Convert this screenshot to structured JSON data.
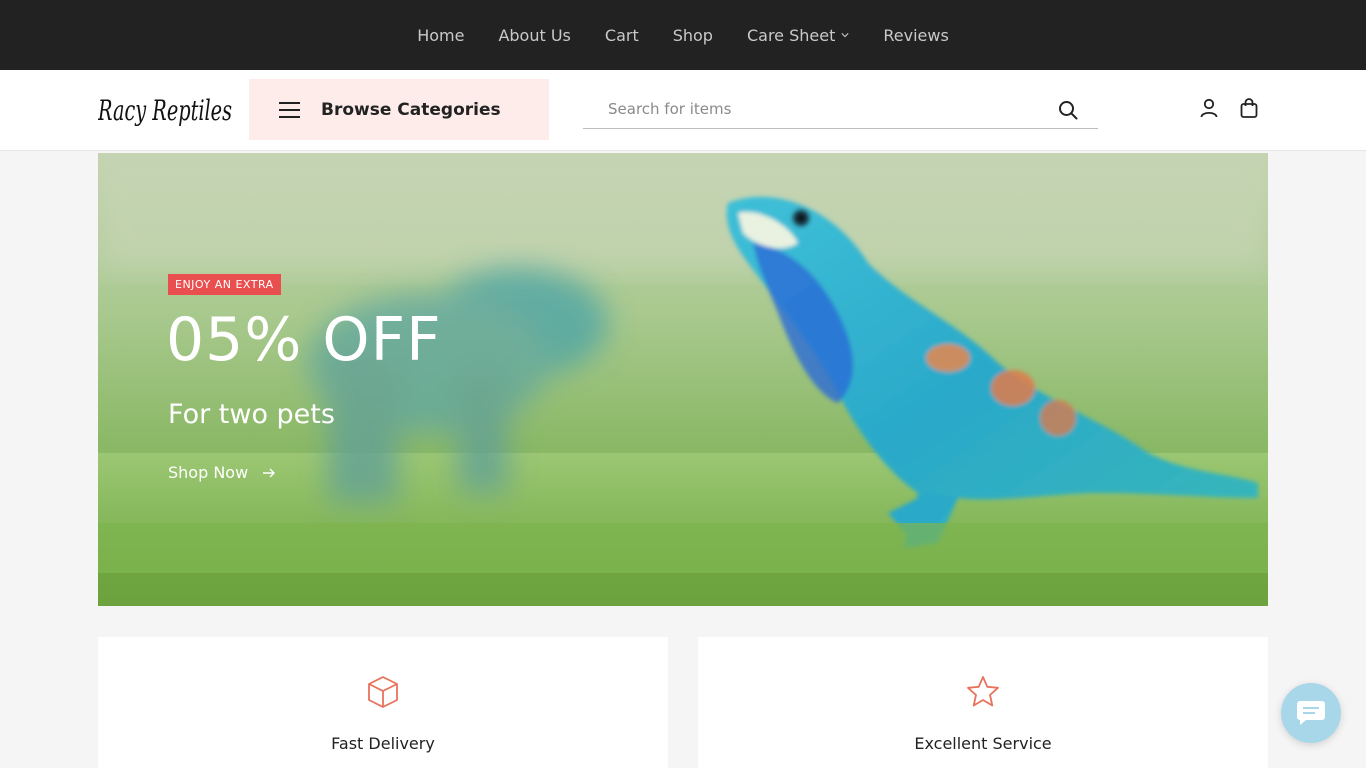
{
  "topnav": {
    "items": [
      {
        "label": "Home"
      },
      {
        "label": "About Us"
      },
      {
        "label": "Cart"
      },
      {
        "label": "Shop"
      },
      {
        "label": "Care Sheet",
        "has_dropdown": true
      },
      {
        "label": "Reviews"
      }
    ]
  },
  "header": {
    "logo_text": "Racy Reptiles",
    "browse_label": "Browse Categories",
    "search_placeholder": "Search for items",
    "icons": [
      "user-icon",
      "shopping-bag-icon"
    ]
  },
  "hero": {
    "badge": "ENJOY AN EXTRA",
    "offer": "05% OFF",
    "subtitle": "For two pets",
    "cta": "Shop Now"
  },
  "features": [
    {
      "title": "Fast Delivery",
      "icon": "box-icon"
    },
    {
      "title": "Excellent Service",
      "icon": "star-icon"
    }
  ],
  "colors": {
    "topbar": "#222222",
    "accent": "#e94f4f",
    "browse_bg": "#fdecea",
    "icon_accent": "#e8725c",
    "chat_bg": "#a9d7ea"
  }
}
